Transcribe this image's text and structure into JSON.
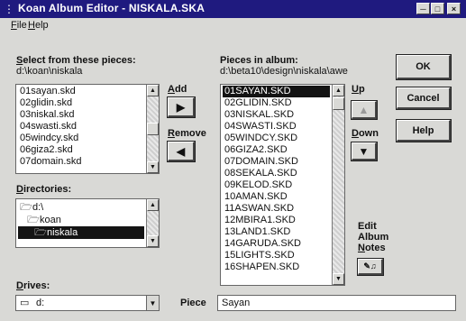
{
  "window": {
    "title": "Koan Album Editor - NISKALA.SKA",
    "icon": "app-icon"
  },
  "menubar": {
    "items": [
      {
        "label": "File"
      },
      {
        "label": "Help"
      }
    ]
  },
  "select": {
    "label": "Select from these pieces:",
    "path": "d:\\koan\\niskala",
    "items": [
      "01sayan.skd",
      "02glidin.skd",
      "03niskal.skd",
      "04swasti.skd",
      "05windcy.skd",
      "06giza2.skd",
      "07domain.skd"
    ]
  },
  "add": {
    "label": "Add"
  },
  "remove": {
    "label": "Remove"
  },
  "album": {
    "label": "Pieces in album:",
    "path": "d:\\beta10\\design\\niskala\\awe",
    "items": [
      "01SAYAN.SKD",
      "02GLIDIN.SKD",
      "03NISKAL.SKD",
      "04SWASTI.SKD",
      "05WINDCY.SKD",
      "06GIZA2.SKD",
      "07DOMAIN.SKD",
      "08SEKALA.SKD",
      "09KELOD.SKD",
      "10AMAN.SKD",
      "11ASWAN.SKD",
      "12MBIRA1.SKD",
      "13LAND1.SKD",
      "14GARUDA.SKD",
      "15LIGHTS.SKD",
      "16SHAPEN.SKD"
    ],
    "selected_index": 0
  },
  "up": {
    "label": "Up"
  },
  "down": {
    "label": "Down"
  },
  "buttons": {
    "ok": "OK",
    "cancel": "Cancel",
    "help": "Help"
  },
  "notes": {
    "label_line1": "Edit",
    "label_line2": "Album",
    "label_line3": "Notes"
  },
  "directories": {
    "label": "Directories:",
    "items": [
      "d:\\",
      "koan",
      "niskala"
    ],
    "selected_index": 2
  },
  "drives": {
    "label": "Drives:",
    "value": "d:"
  },
  "piece": {
    "label": "Piece",
    "value": "Sayan"
  }
}
